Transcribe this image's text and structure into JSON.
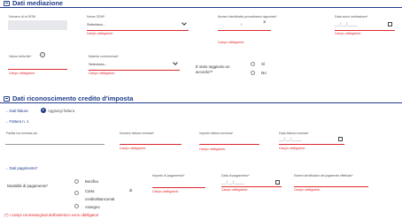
{
  "dati_mediazione": {
    "title": "Dati mediazione",
    "numero_rgm_label": "Numero di rir RGM",
    "nome_odm_label": "Nome ODM*",
    "nome_odm_value": "Seleziona...",
    "nome_odm_error": "Campo obbligatorio",
    "numero_identificativo_label": "Numero identificativo procedimento rapportato*",
    "numero_identificativo_value": "/",
    "numero_identificativo_clear": "×",
    "numero_identificativo_error": "Campo obbligatorio",
    "data_avvio_label": "Data avvio mediazione*",
    "data_avvio_placeholder": "__/__/____",
    "data_avvio_error": "Campo obbligatorio",
    "valore_lite_label": "Valore della lite*",
    "valore_lite_error": "Campo obbligatorio",
    "materia_label": "Materia controversia*",
    "materia_value": "Seleziona...",
    "materia_error": "Campo obbligatorio",
    "accordo_question": "È stato raggiunto un accordo?*",
    "accordo_options": [
      "Sì",
      "No"
    ]
  },
  "credito": {
    "title": "Dati riconoscimento credito d'imposta",
    "dati_fattura_link": "Dati fattura",
    "aggiungi_fattura": "Aggiungi fattura",
    "fattura_link": "Fattura n. 1",
    "partita_iva_label": "Partita iva emessa da:",
    "numero_fattura_label": "Numero fattura emessa*",
    "numero_fattura_error": "Campo obbligatorio",
    "importo_fattura_label": "Importo fattura emessa*",
    "importo_fattura_error": "Campo obbligatorio",
    "data_fattura_label": "Data fattura emessa*",
    "data_fattura_placeholder": "__/__/____",
    "data_fattura_error": "Campo obbligatorio",
    "dati_pagamento_link": "Dati pagamento*",
    "modalita_label": "Modalità di pagamento*",
    "modalita_options": [
      "Bonifico",
      "Carta credito/Bancomat",
      "Assegno"
    ],
    "di_label": "di",
    "importo_pagamento_label": "Importo di pagamento*",
    "importo_pagamento_error": "Campo obbligatorio",
    "data_pagamento_label": "Data di pagamento*",
    "data_pagamento_placeholder": "__/__/____",
    "data_pagamento_error": "Campo obbligatorio",
    "estremi_label": "Estremi identificativo del pagamento effettuato*",
    "estremi_error": "Campo obbligatorio"
  },
  "footer_note": "(*) I campi contrassegnati dall'asterisco sono obbligatori",
  "colors": {
    "accent": "#1f3c8a",
    "error": "#e0262a",
    "input_bg": "#e6e8ec"
  },
  "icons": [
    "document-icon",
    "calendar-icon",
    "info-icon",
    "chevron-down-icon",
    "arrow-right-icon",
    "add-circle-icon",
    "close-icon"
  ]
}
